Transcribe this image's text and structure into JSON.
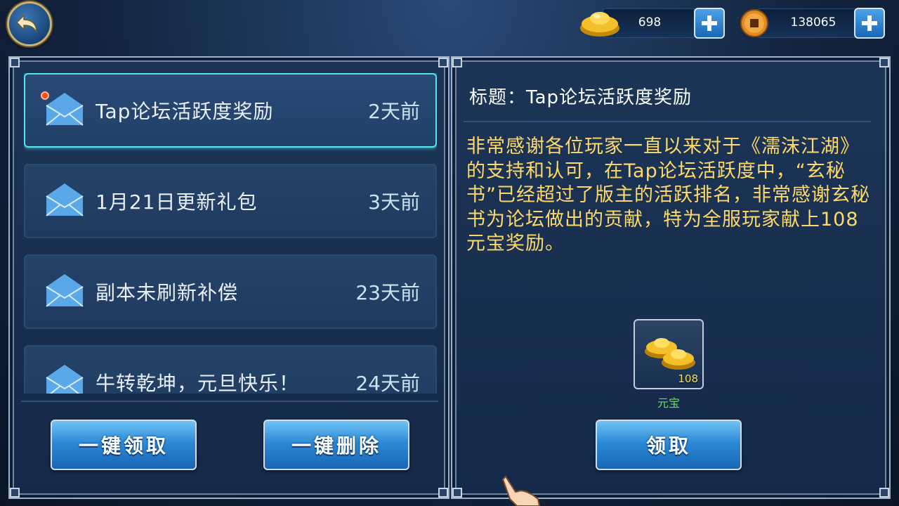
{
  "header": {
    "back_label": "",
    "gold": {
      "icon": "gold-ingot-icon",
      "value": "698"
    },
    "copper": {
      "icon": "copper-coin-icon",
      "value": "138065"
    }
  },
  "mail_list": {
    "items": [
      {
        "title": "Tap论坛活跃度奖励",
        "time": "2天前",
        "unread": true,
        "selected": true
      },
      {
        "title": "1月21日更新礼包",
        "time": "3天前",
        "unread": false,
        "selected": false
      },
      {
        "title": "副本未刷新补偿",
        "time": "23天前",
        "unread": false,
        "selected": false
      },
      {
        "title": "牛转乾坤，元旦快乐！",
        "time": "24天前",
        "unread": false,
        "selected": false
      }
    ],
    "collect_all_label": "一键领取",
    "delete_all_label": "一键删除"
  },
  "detail": {
    "title": "标题：Tap论坛活跃度奖励",
    "body": "非常感谢各位玩家一直以来对于《濡沫江湖》的支持和认可，在Tap论坛活跃度中，“玄秘书”已经超过了版主的活跃排名，非常感谢玄秘书为论坛做出的贡献，特为全服玩家献上108元宝奖励。",
    "reward": {
      "icon": "yuanbao-icon",
      "count": "108",
      "name": "元宝"
    },
    "claim_label": "领取"
  },
  "colors": {
    "accent": "#52e6ef",
    "body_text": "#ffd86a",
    "reward_name": "#5fe24d",
    "unread_dot": "#ff4d1a"
  }
}
